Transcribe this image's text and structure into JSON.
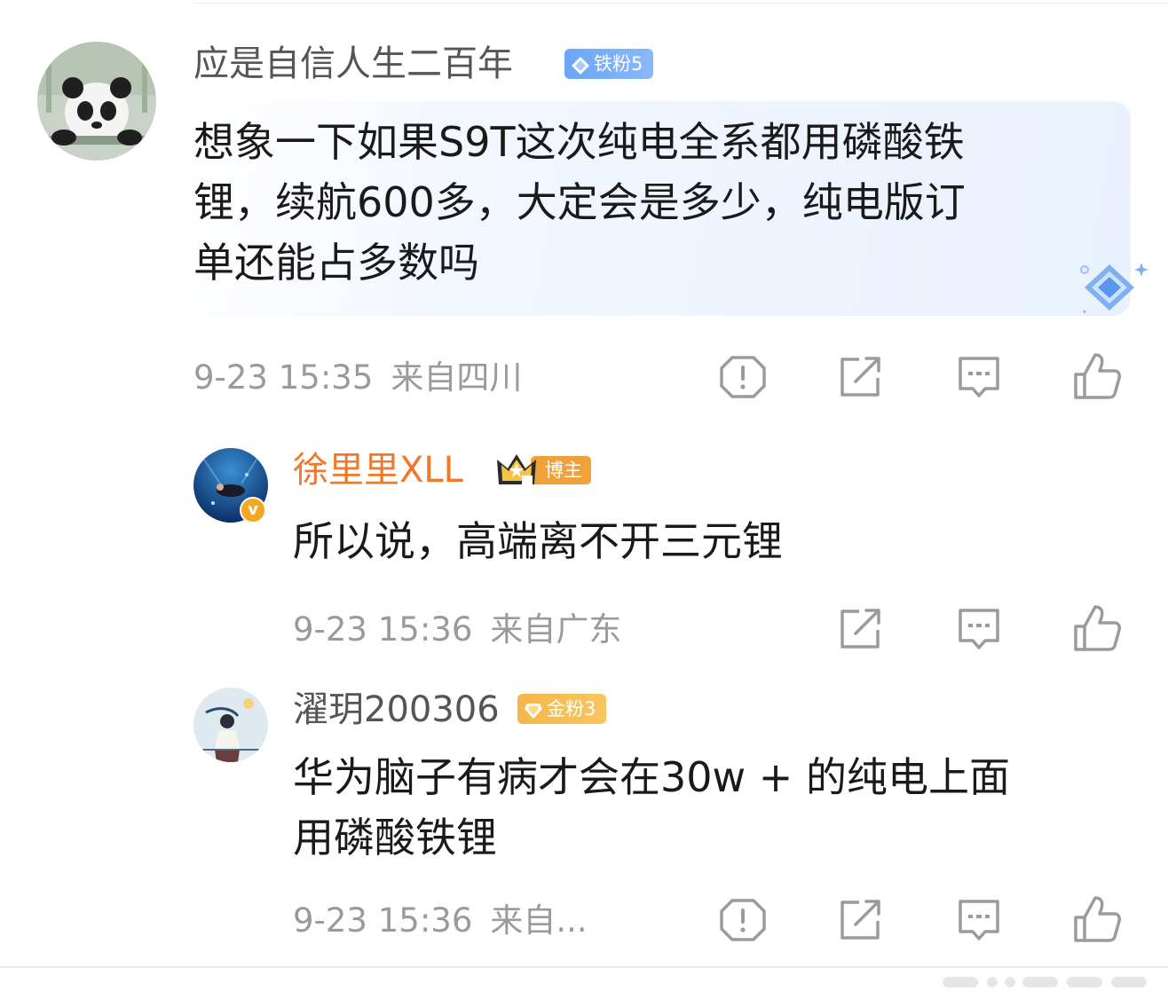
{
  "comments": {
    "main": {
      "username": "应是自信人生二百年",
      "fan_badge": "铁粉5",
      "text_lines": [
        "想象一下如果S9T这次纯电全系都用磷酸铁",
        "锂，续航600多，大定会是多少，纯电版订",
        "单还能占多数吗"
      ],
      "time": "9-23 15:35",
      "location": "来自四川"
    },
    "reply1": {
      "username": "徐里里XLL",
      "author_badge": "博主",
      "verified": "v",
      "text": "所以说，高端离不开三元锂",
      "time": "9-23 15:36",
      "location": "来自广东"
    },
    "reply2": {
      "username": "濯玥200306",
      "fan_badge": "金粉3",
      "text_lines": [
        "华为脑子有病才会在30w + 的纯电上面",
        "用磷酸铁锂"
      ],
      "time": "9-23 15:36",
      "location": "来自..."
    }
  },
  "icons": {
    "report": "report-icon",
    "share": "share-icon",
    "comment": "comment-icon",
    "like": "like-icon"
  },
  "colors": {
    "username_gray": "#555555",
    "blogger_orange": "#f0782a",
    "meta_gray": "#9a9a9a",
    "text_black": "#1a1a1a",
    "icon_gray": "#9b9b9b",
    "iron_fan_blue": "#6aa6f5",
    "gold_fan": "#f5b64a",
    "highlight_blue": "#e9f1fd"
  }
}
